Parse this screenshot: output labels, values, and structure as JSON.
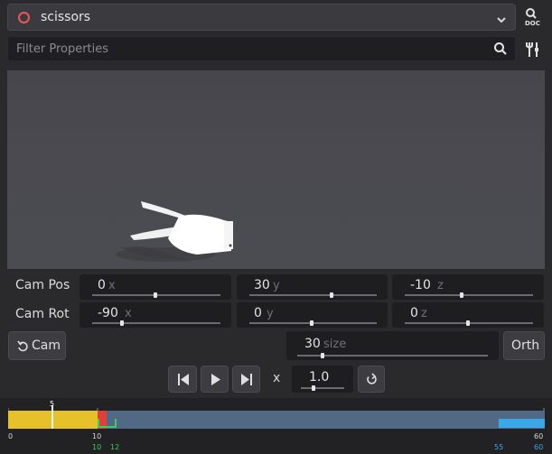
{
  "header": {
    "selected_item": "scissors",
    "doc_label": "DOC"
  },
  "filter": {
    "placeholder": "Filter Properties"
  },
  "cam_pos": {
    "label": "Cam Pos",
    "x": {
      "value": "0",
      "unit": "x"
    },
    "y": {
      "value": "30",
      "unit": "y"
    },
    "z": {
      "value": "-10",
      "unit": "z"
    }
  },
  "cam_rot": {
    "label": "Cam Rot",
    "x": {
      "value": "-90",
      "unit": "x"
    },
    "y": {
      "value": "0",
      "unit": "y"
    },
    "z": {
      "value": "0",
      "unit": "z"
    }
  },
  "cam_button": {
    "label": "Cam"
  },
  "size": {
    "value": "30",
    "unit": "size"
  },
  "orth_button": {
    "label": "Orth"
  },
  "playback": {
    "speed_prefix": "x",
    "speed": "1.0"
  },
  "timeline": {
    "cursor_label": "5",
    "ticks": {
      "start": "0",
      "mid": "10",
      "end": "60"
    },
    "markers": {
      "green_start": "10",
      "green_end": "12",
      "blue_start": "55",
      "blue_end": "60"
    },
    "colors": {
      "yellow": "#e6c12a",
      "red": "#e0403c",
      "bar": "#506a85",
      "green": "#38d05a",
      "blue": "#3aa8e8"
    }
  }
}
